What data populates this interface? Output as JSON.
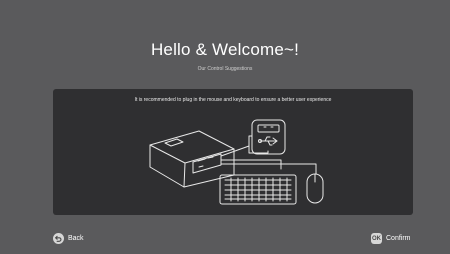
{
  "header": {
    "title": "Hello & Welcome~!",
    "subtitle": "Our Control Suggestions"
  },
  "panel": {
    "message": "It is recommended to plug in the mouse and keyboard to ensure a better user experience",
    "illustration": {
      "devices": [
        "projector",
        "usb-port",
        "keyboard",
        "mouse"
      ]
    }
  },
  "footer": {
    "back": {
      "icon": "back-arrow-icon",
      "label": "Back"
    },
    "confirm": {
      "key": "OK",
      "label": "Confirm"
    }
  },
  "colors": {
    "background": "#5a5a5c",
    "panel": "#2f2f31",
    "line": "#e8e8e8"
  }
}
